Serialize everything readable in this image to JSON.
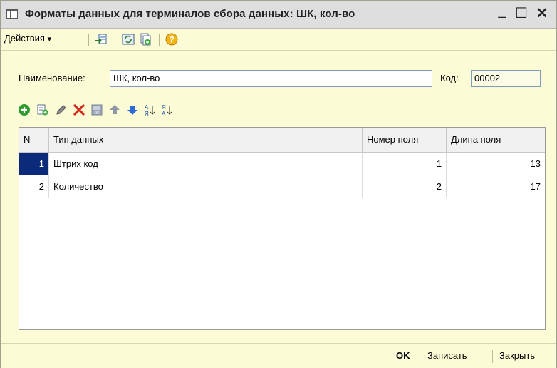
{
  "window": {
    "title": "Форматы данных для терминалов сбора данных: ШК, кол-во",
    "minimize": "_",
    "maximize": "☐",
    "close": "✕"
  },
  "toolbar": {
    "actions_label": "Действия",
    "actions_arrow": "▾"
  },
  "form": {
    "name_label": "Наименование:",
    "name_value": "ШК, кол-во",
    "code_label": "Код:",
    "code_value": "00002"
  },
  "table": {
    "columns": [
      "N",
      "Тип данных",
      "Номер поля",
      "Длина поля"
    ],
    "rows": [
      {
        "n": "1",
        "type": "Штрих код",
        "field_no": "1",
        "field_len": "13"
      },
      {
        "n": "2",
        "type": "Количество",
        "field_no": "2",
        "field_len": "17"
      }
    ]
  },
  "footer": {
    "ok_label": "OK",
    "save_label": "Записать",
    "close_label": "Закрыть"
  }
}
